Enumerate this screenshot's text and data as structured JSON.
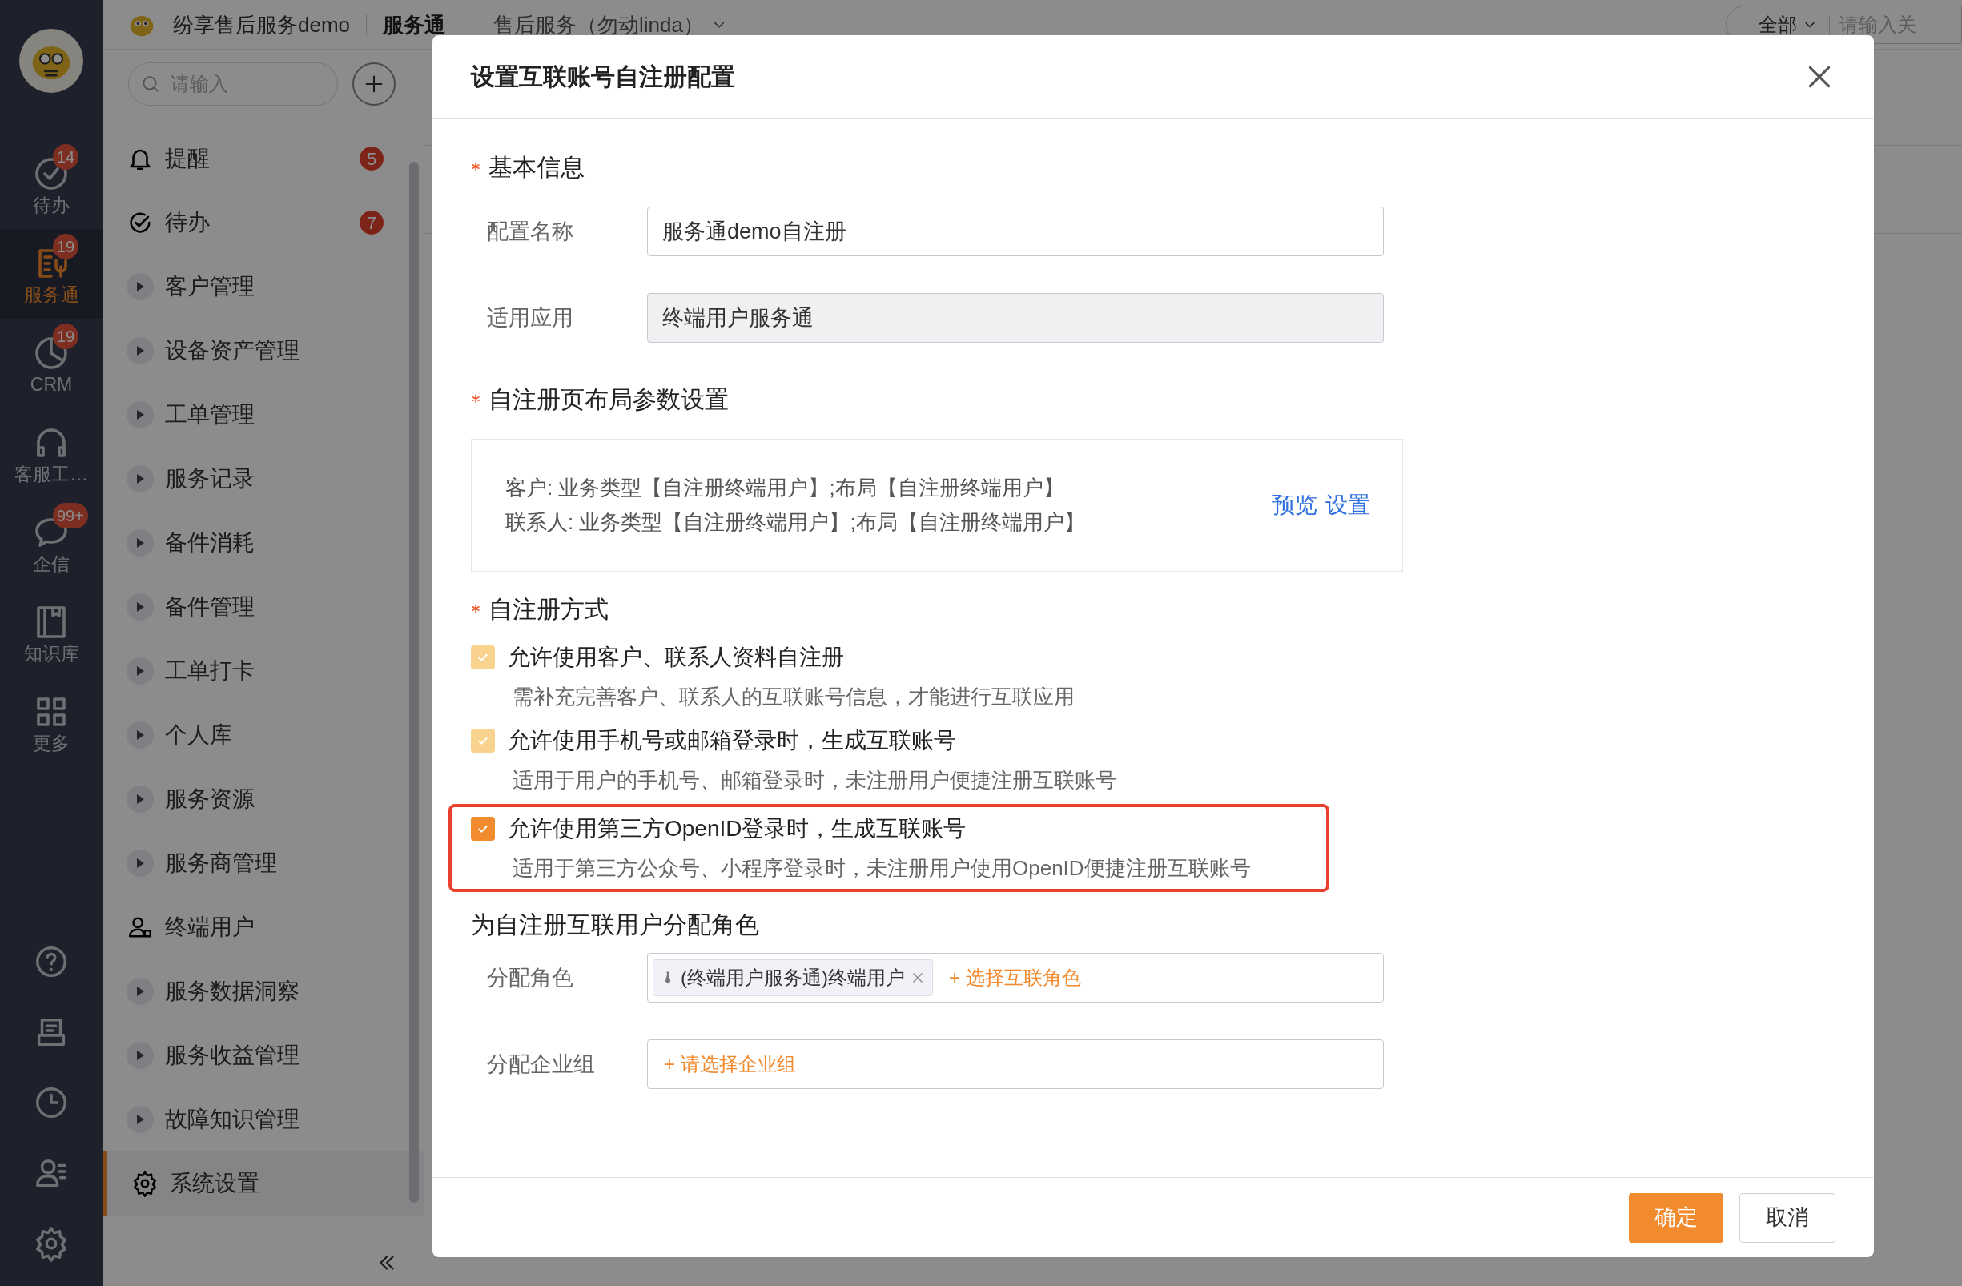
{
  "header": {
    "app_name": "纷享售后服务demo",
    "module": "服务通",
    "space": "售后服务（勿动linda）",
    "filter": "全部",
    "search_placeholder": "请输入关"
  },
  "rail": {
    "items": [
      {
        "label": "待办",
        "badge": "14",
        "selected": false
      },
      {
        "label": "服务通",
        "badge": "19",
        "selected": true
      },
      {
        "label": "CRM",
        "badge": "19",
        "selected": false
      },
      {
        "label": "客服工…",
        "selected": false
      },
      {
        "label": "企信",
        "badge": "99+",
        "selected": false
      },
      {
        "label": "知识库",
        "selected": false
      },
      {
        "label": "更多",
        "selected": false
      }
    ]
  },
  "sidebar": {
    "search_placeholder": "请输入",
    "items": [
      {
        "label": "提醒",
        "kind": "icon",
        "badge": "5",
        "selected": false
      },
      {
        "label": "待办",
        "kind": "icon",
        "badge": "7",
        "selected": false
      },
      {
        "label": "客户管理",
        "kind": "group",
        "selected": false
      },
      {
        "label": "设备资产管理",
        "kind": "group",
        "selected": false
      },
      {
        "label": "工单管理",
        "kind": "group",
        "selected": false
      },
      {
        "label": "服务记录",
        "kind": "group",
        "selected": false
      },
      {
        "label": "备件消耗",
        "kind": "group",
        "selected": false
      },
      {
        "label": "备件管理",
        "kind": "group",
        "selected": false
      },
      {
        "label": "工单打卡",
        "kind": "group",
        "selected": false
      },
      {
        "label": "个人库",
        "kind": "group",
        "selected": false
      },
      {
        "label": "服务资源",
        "kind": "group",
        "selected": false
      },
      {
        "label": "服务商管理",
        "kind": "group",
        "selected": false
      },
      {
        "label": "终端用户",
        "kind": "icon",
        "selected": false
      },
      {
        "label": "服务数据洞察",
        "kind": "group",
        "selected": false
      },
      {
        "label": "服务收益管理",
        "kind": "group",
        "selected": false
      },
      {
        "label": "故障知识管理",
        "kind": "group",
        "selected": false
      },
      {
        "label": "系统设置",
        "kind": "icon",
        "selected": true
      }
    ]
  },
  "modal": {
    "title": "设置互联账号自注册配置",
    "basic": {
      "heading": "基本信息",
      "required": true,
      "fields": [
        {
          "label": "配置名称",
          "value": "服务通demo自注册",
          "disabled": false
        },
        {
          "label": "适用应用",
          "value": "终端用户服务通",
          "disabled": true
        }
      ]
    },
    "layout": {
      "heading": "自注册页布局参数设置",
      "required": true,
      "lines": [
        "客户: 业务类型【自注册终端用户】;布局【自注册终端用户】",
        "联系人: 业务类型【自注册终端用户】;布局【自注册终端用户】"
      ],
      "links": [
        "预览",
        "设置"
      ]
    },
    "methods": {
      "heading": "自注册方式",
      "required": true,
      "options": [
        {
          "label": "允许使用客户、联系人资料自注册",
          "description": "需补充完善客户、联系人的互联账号信息，才能进行互联应用",
          "checked": true,
          "disabled": true,
          "highlighted": false
        },
        {
          "label": "允许使用手机号或邮箱登录时，生成互联账号",
          "description": "适用于用户的手机号、邮箱登录时，未注册用户便捷注册互联账号",
          "checked": true,
          "disabled": true,
          "highlighted": false
        },
        {
          "label": "允许使用第三方OpenID登录时，生成互联账号",
          "description": "适用于第三方公众号、小程序登录时，未注册用户使用OpenID便捷注册互联账号",
          "checked": true,
          "disabled": false,
          "highlighted": true
        }
      ]
    },
    "roles": {
      "heading": "为自注册互联用户分配角色",
      "required": false,
      "role_label": "分配角色",
      "role_tags": [
        "(终端用户服务通)终端用户"
      ],
      "role_add": "+ 选择互联角色",
      "group_label": "分配企业组",
      "group_add": "+ 请选择企业组"
    },
    "buttons": {
      "confirm": "确定",
      "cancel": "取消"
    }
  }
}
